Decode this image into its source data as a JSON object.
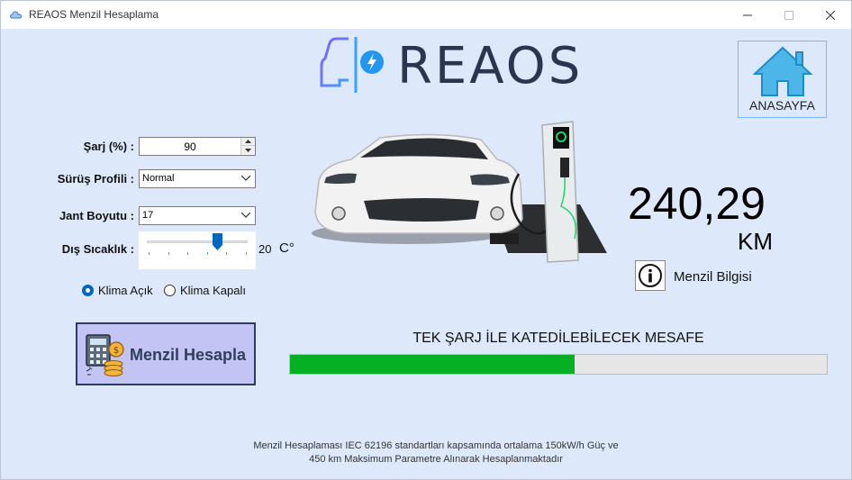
{
  "window": {
    "title": "REAOS Menzil Hesaplama"
  },
  "logo": {
    "text": "REAOS"
  },
  "home_button": {
    "label": "ANASAYFA",
    "icon": "house-icon"
  },
  "form": {
    "charge_label": "Şarj (%) :",
    "charge_value": "90",
    "profile_label": "Sürüş Profili :",
    "profile_value": "Normal",
    "rim_label": "Jant Boyutu :",
    "rim_value": "17",
    "temp_label": "Dış Sıcaklık :",
    "temp_value": "20",
    "temp_unit": "C°",
    "temp_level": 0.7,
    "climate_on_label": "Klima Açık",
    "climate_off_label": "Klima Kapalı",
    "climate_selected": "on"
  },
  "calc_button": {
    "label": "Menzil Hesapla",
    "icon": "calculator-coins-icon"
  },
  "result": {
    "range_value": "240,29",
    "range_unit": "KM",
    "info_label": "Menzil Bilgisi"
  },
  "progress": {
    "title": "TEK ŞARJ İLE KATEDİLEBİLECEK MESAFE",
    "fraction": 0.53,
    "fill_color": "#06b025"
  },
  "footnote": {
    "line1": "Menzil Hesaplaması IEC 62196 standartları kapsamında ortalama 150kW/h Güç ve",
    "line2": "450 km Maksimum Parametre Alınarak Hesaplanmaktadır"
  }
}
